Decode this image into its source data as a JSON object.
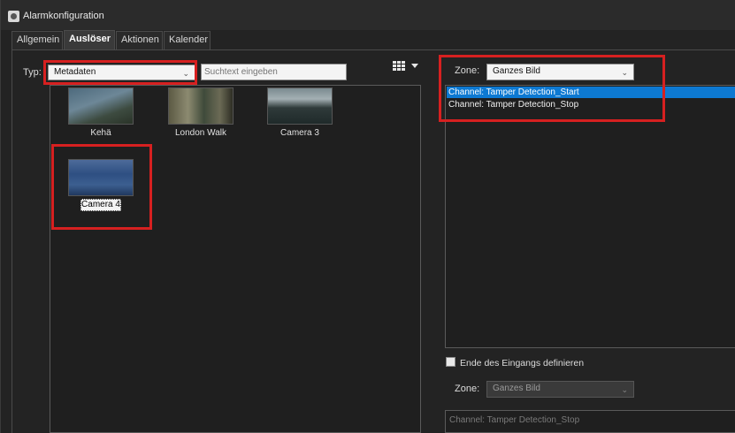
{
  "window": {
    "title": "Alarmkonfiguration"
  },
  "tabs": [
    {
      "label": "Allgemein",
      "active": false
    },
    {
      "label": "Auslöser",
      "active": true
    },
    {
      "label": "Aktionen",
      "active": false
    },
    {
      "label": "Kalender",
      "active": false
    }
  ],
  "filter": {
    "typ_label": "Typ:",
    "typ_value": "Metadaten",
    "search_placeholder": "Suchtext eingeben"
  },
  "cameras": [
    {
      "name": "Kehä",
      "selected": false
    },
    {
      "name": "London Walk",
      "selected": false
    },
    {
      "name": "Camera 3",
      "selected": false
    },
    {
      "name": "Camera 4",
      "selected": true
    }
  ],
  "zone": {
    "label": "Zone:",
    "value": "Ganzes Bild"
  },
  "channels": [
    {
      "label": "Channel: Tamper Detection_Start",
      "selected": true
    },
    {
      "label": "Channel: Tamper Detection_Stop",
      "selected": false
    }
  ],
  "end_of_input": {
    "checkbox_label": "Ende des Eingangs definieren",
    "checked": false,
    "zone_label": "Zone:",
    "zone_value": "Ganzes Bild",
    "channels": [
      {
        "label": "Channel: Tamper Detection_Stop"
      }
    ]
  },
  "colors": {
    "highlight_red": "#d62020",
    "selection_blue": "#0d79d2"
  }
}
